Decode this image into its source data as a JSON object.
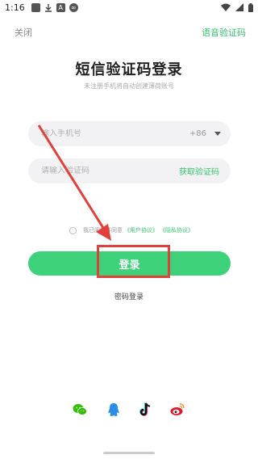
{
  "status_bar": {
    "time": "1:16",
    "left_icons": [
      "notification-square-icon",
      "download-icon",
      "app-a-icon",
      "app-round-icon"
    ],
    "right_icons": [
      "wifi-icon",
      "signal-icon",
      "battery-icon"
    ]
  },
  "header": {
    "close_label": "关闭",
    "voice_code_label": "语音验证码"
  },
  "main": {
    "title": "短信验证码登录",
    "subtitle": "未注册手机将自动创建薄荷账号"
  },
  "form": {
    "phone_placeholder": "输入手机号",
    "country_code": "+86",
    "code_placeholder": "请输入验证码",
    "get_code_label": "获取验证码"
  },
  "agreement": {
    "prefix": "我已阅读并同意",
    "user_agreement": "《用户协议》",
    "privacy_policy": "《隐私协议》"
  },
  "actions": {
    "login_label": "登录",
    "password_login_label": "密码登录"
  },
  "social": [
    "wechat-icon",
    "qq-icon",
    "tiktok-icon",
    "weibo-icon"
  ],
  "colors": {
    "accent": "#3dd17a",
    "accent_text": "#35c46f",
    "annotation": "#e0413b"
  }
}
